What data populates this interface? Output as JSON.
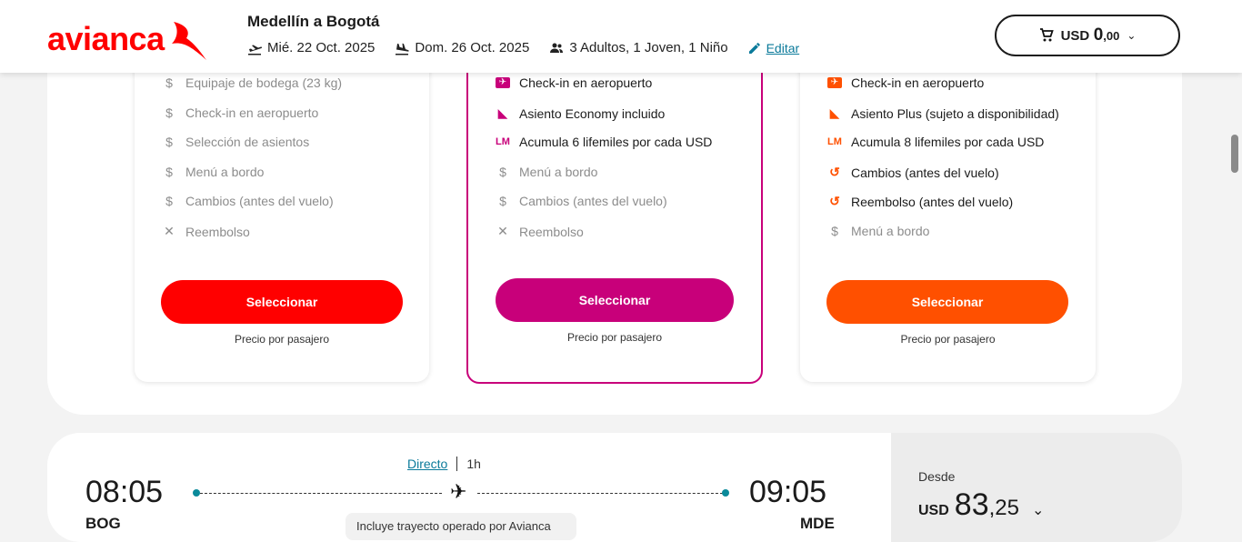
{
  "header": {
    "brand": "avianca",
    "route": "Medellín a Bogotá",
    "depart_date": "Mié. 22 Oct. 2025",
    "return_date": "Dom. 26 Oct. 2025",
    "passengers": "3 Adultos, 1 Joven, 1 Niño",
    "edit_label": "Editar",
    "cart_currency": "USD",
    "cart_amount": "0",
    "cart_decimals": ",00"
  },
  "colors": {
    "brand_red": "#ff0000",
    "magenta": "#c8007a",
    "orange": "#ff5000",
    "teal": "#0a8a9a"
  },
  "fares": [
    {
      "features": [
        {
          "icon": "dollar-icon",
          "glyph": "$",
          "label": "Equipaje de bodega (23 kg)",
          "included": false
        },
        {
          "icon": "dollar-icon",
          "glyph": "$",
          "label": "Check-in en aeropuerto",
          "included": false
        },
        {
          "icon": "dollar-icon",
          "glyph": "$",
          "label": "Selección de asientos",
          "included": false
        },
        {
          "icon": "dollar-icon",
          "glyph": "$",
          "label": "Menú a bordo",
          "included": false
        },
        {
          "icon": "dollar-icon",
          "glyph": "$",
          "label": "Cambios (antes del vuelo)",
          "included": false
        },
        {
          "icon": "x-icon",
          "glyph": "✕",
          "label": "Reembolso",
          "included": false
        }
      ],
      "select_label": "Seleccionar",
      "price_note": "Precio por pasajero"
    },
    {
      "features": [
        {
          "icon": "checkin-icon",
          "glyph": "✈",
          "label": "Check-in en aeropuerto",
          "included": true
        },
        {
          "icon": "seat-icon",
          "glyph": "◣",
          "label": "Asiento Economy incluido",
          "included": true
        },
        {
          "icon": "lifemiles-icon",
          "glyph": "LM",
          "label": "Acumula 6 lifemiles por cada USD",
          "included": true
        },
        {
          "icon": "dollar-icon",
          "glyph": "$",
          "label": "Menú a bordo",
          "included": false
        },
        {
          "icon": "dollar-icon",
          "glyph": "$",
          "label": "Cambios (antes del vuelo)",
          "included": false
        },
        {
          "icon": "x-icon",
          "glyph": "✕",
          "label": "Reembolso",
          "included": false
        }
      ],
      "select_label": "Seleccionar",
      "price_note": "Precio por pasajero"
    },
    {
      "features": [
        {
          "icon": "checkin-icon",
          "glyph": "✈",
          "label": "Check-in en aeropuerto",
          "included": true
        },
        {
          "icon": "seat-icon",
          "glyph": "◣",
          "label": "Asiento Plus (sujeto a disponibilidad)",
          "included": true
        },
        {
          "icon": "lifemiles-icon",
          "glyph": "LM",
          "label": "Acumula 8 lifemiles por cada USD",
          "included": true
        },
        {
          "icon": "history-icon",
          "glyph": "↺",
          "label": "Cambios (antes del vuelo)",
          "included": true
        },
        {
          "icon": "refund-icon",
          "glyph": "↺",
          "label": "Reembolso (antes del vuelo)",
          "included": true
        },
        {
          "icon": "dollar-icon",
          "glyph": "$",
          "label": "Menú a bordo",
          "included": false
        }
      ],
      "select_label": "Seleccionar",
      "price_note": "Precio por pasajero"
    }
  ],
  "flight": {
    "depart_time": "08:05",
    "arrive_time": "09:05",
    "origin": "BOG",
    "destination": "MDE",
    "stops_label": "Directo",
    "duration": "1h",
    "operated_note": "Incluye trayecto operado por Avianca",
    "from_label": "Desde",
    "currency": "USD",
    "price_int": "83",
    "price_dec": ",25"
  }
}
